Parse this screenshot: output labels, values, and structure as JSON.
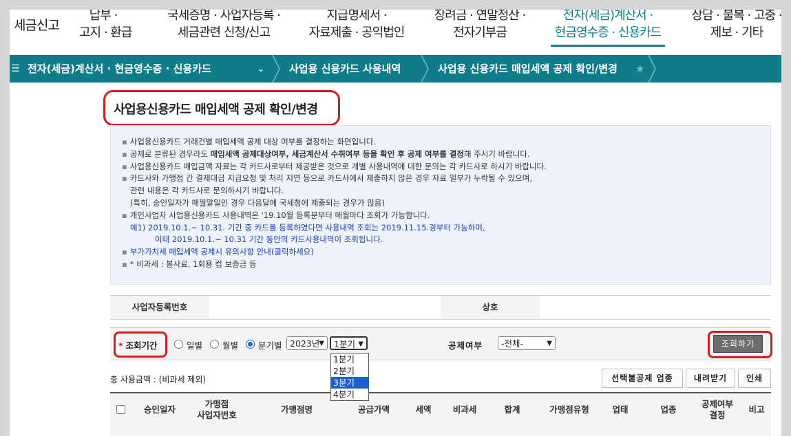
{
  "top_nav": {
    "brand": "세금신고",
    "menus": [
      {
        "line1": "납부 ·",
        "line2": "고지 · 환급"
      },
      {
        "line1": "국세증명 · 사업자등록 ·",
        "line2": "세금관련 신청/신고"
      },
      {
        "line1": "지급명세서 ·",
        "line2": "자료제출 · 공익법인"
      },
      {
        "line1": "장려금 · 연말정산 ·",
        "line2": "전자기부금"
      },
      {
        "line1": "전자(세금)계산서 ·",
        "line2": "현금영수증 · 신용카드"
      },
      {
        "line1": "상담 · 불복 · 고충 ·",
        "line2": "제보 · 기타"
      }
    ]
  },
  "breadcrumb": {
    "menu_icon": "hamburger-icon",
    "item1": "전자(세금)계산서 · 현금영수증 · 신용카드",
    "item2": "사업용 신용카드 사용내역",
    "item3": "사업용 신용카드 매입세액 공제 확인/변경"
  },
  "page_title": "사업용신용카드 매입세액 공제 확인/변경",
  "notice": {
    "l1": "사업용신용카드 거래건별 매입세액 공제 대상 여부를 결정하는 화면입니다.",
    "l2a": "공제로 분류된 경우라도 ",
    "l2b": "매입세액 공제대상여부, 세금계산서 수취여부 등을 확인 후 공제 여부를 결정",
    "l2c": "해 주시기 바랍니다.",
    "l3": "사업용신용카드 매입금액 자료는 각 카드사로부터 제공받은 것으로 개별 사용내역에 대한 문의는 각 카드사로 하시기 바랍니다.",
    "l4": "카드사와 가맹점 간 결제대금 지급요청 및 처리 지연 등으로 카드사에서 제출하지 않은 경우 자료 일부가 누락될 수 있으며,",
    "l5": "관련 내용은 각 카드사로 문의하시기 바랍니다.",
    "l6": "(특히, 승인일자가 매월말일인 경우 다음달에 국세청에 제출되는 경우가 많음)",
    "l7": "개인사업자 사업용신용카드 사용내역은 '19.10월 등록분부터 매월마다 조회가 가능합니다.",
    "l8": "예1) 2019.10.1.~ 10.31. 기간 중 카드를 등록하였다면 사용내역 조회는 2019.11.15.경부터 가능하며,",
    "l9": "이때 2019.10.1.~ 10.31 기간 동안의 카드사용내역이 조회됩니다.",
    "l10": "부가가치세 매입세액 공제시 유의사항 안내(클릭하세요)",
    "l11": "* 비과세 : 봉사료, 1회용 컵 보증금 등"
  },
  "biz_row": {
    "biz_no_label": "사업자등록번호",
    "biz_no_value": "",
    "company_label": "상호",
    "company_value": ""
  },
  "search": {
    "period_label": "조회기간",
    "radio_daily": "일별",
    "radio_monthly": "월별",
    "radio_quarterly": "분기별",
    "year_value": "2023년",
    "quarter_value": "1분기",
    "quarter_options": [
      "1분기",
      "2분기",
      "3분기",
      "4분기"
    ],
    "deduction_label": "공제여부",
    "deduction_value": "-전체-",
    "search_button": "조회하기"
  },
  "summary": {
    "total_label": "총 사용금액 : (비과세 제외)"
  },
  "actions": {
    "bulk_button": "선택불공제 업종",
    "download_button": "내려받기",
    "print_button": "인쇄"
  },
  "table": {
    "headers": {
      "approval_date": "승인일자",
      "merchant_biz_1": "가맹점",
      "merchant_biz_2": "사업자번호",
      "merchant_name": "가맹점명",
      "supply": "공급가액",
      "tax": "세액",
      "nontax": "비과세",
      "total": "합계",
      "merchant_type": "가맹점유형",
      "business_type": "업태",
      "business_item": "업종",
      "deduct_1": "공제여부",
      "deduct_2": "결정",
      "note": "비고"
    }
  },
  "colors": {
    "teal": "#0f7c89",
    "active_menu": "#0b7f8c",
    "highlight_red": "#e01818",
    "notice_blue": "#1a3ec4",
    "dropdown_selected": "#1f5dd2"
  }
}
